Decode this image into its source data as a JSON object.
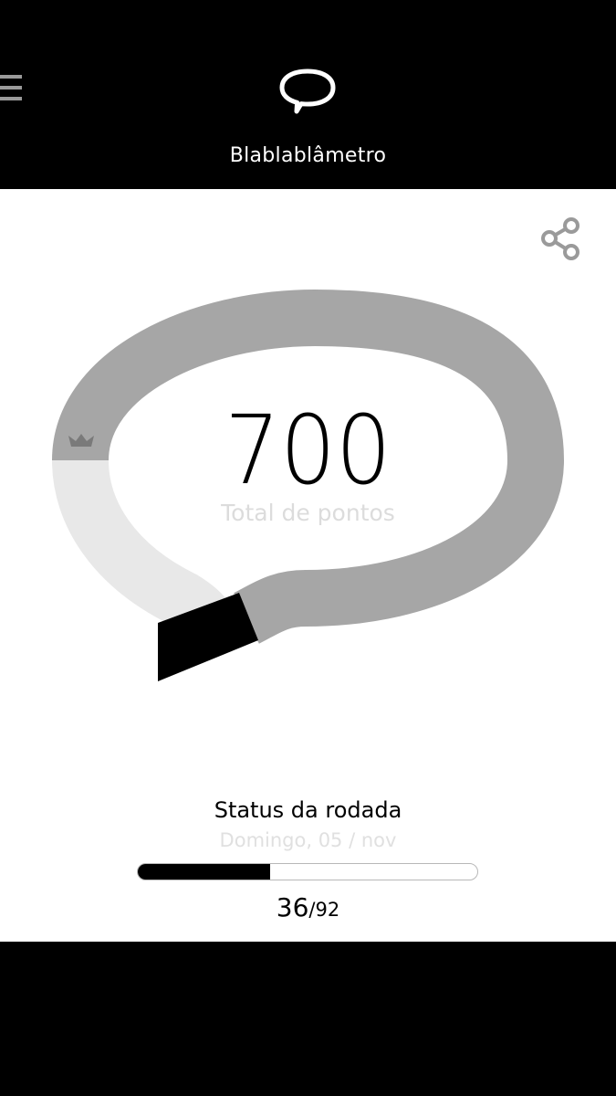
{
  "header": {
    "title": "Blablablâmetro",
    "menu_icon": "hamburger-menu-icon",
    "logo_icon": "speech-bubble-icon"
  },
  "toolbar": {
    "share_icon": "share-icon"
  },
  "meter": {
    "total_points": "700",
    "total_label": "Total de pontos",
    "level_fraction": 0.13,
    "marker_icon": "crown-icon",
    "colors": {
      "track": "#a6a6a6",
      "lower_track": "#e8e8e8",
      "tail": "#000000"
    }
  },
  "round_status": {
    "title": "Status da rodada",
    "date": "Domingo, 05 / nov",
    "current": "36",
    "total": "/92",
    "progress": 0.391
  }
}
